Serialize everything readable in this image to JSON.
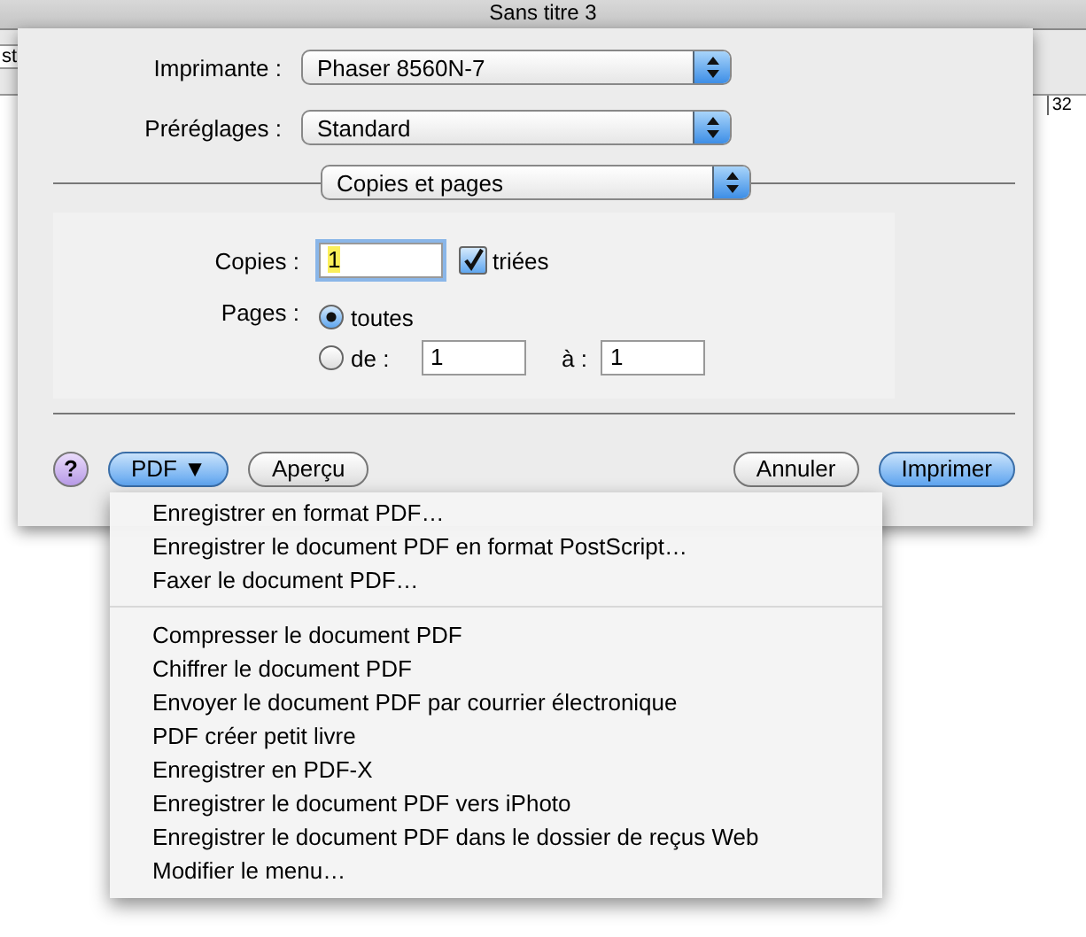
{
  "window": {
    "title": "Sans titre 3"
  },
  "document": {
    "toolbar_text": "st",
    "ruler_label": "32"
  },
  "print_sheet": {
    "popups": [
      {
        "label": "Imprimante :",
        "value": "Phaser 8560N-7"
      },
      {
        "label": "Préréglages :",
        "value": "Standard"
      }
    ],
    "section_popup": {
      "value": "Copies et pages"
    },
    "copies": {
      "label": "Copies :",
      "value": "1",
      "highlighted": true,
      "collated": {
        "label": "triées",
        "checked": true
      }
    },
    "pages": {
      "label": "Pages :",
      "options": [
        {
          "label": "toutes",
          "selected": true
        },
        {
          "label": "de :",
          "selected": false
        }
      ],
      "from": "1",
      "to_label": "à :",
      "to": "1"
    },
    "buttons": [
      {
        "kind": "help",
        "label": "?"
      },
      {
        "kind": "menu",
        "label": "PDF ▼"
      },
      {
        "kind": "normal",
        "label": "Aperçu"
      },
      {
        "kind": "normal",
        "label": "Annuler"
      },
      {
        "kind": "default",
        "label": "Imprimer"
      }
    ]
  },
  "pdf_menu": {
    "groups": [
      [
        "Enregistrer en format PDF…",
        "Enregistrer le document PDF en format PostScript…",
        "Faxer le document PDF…"
      ],
      [
        "Compresser le document PDF",
        "Chiffrer le document PDF",
        "Envoyer le document PDF par courrier électronique",
        "PDF créer petit livre",
        "Enregistrer en PDF-X",
        "Enregistrer le document PDF vers iPhoto",
        "Enregistrer le document PDF dans le dossier de reçus Web",
        "Modifier le menu…"
      ]
    ]
  }
}
